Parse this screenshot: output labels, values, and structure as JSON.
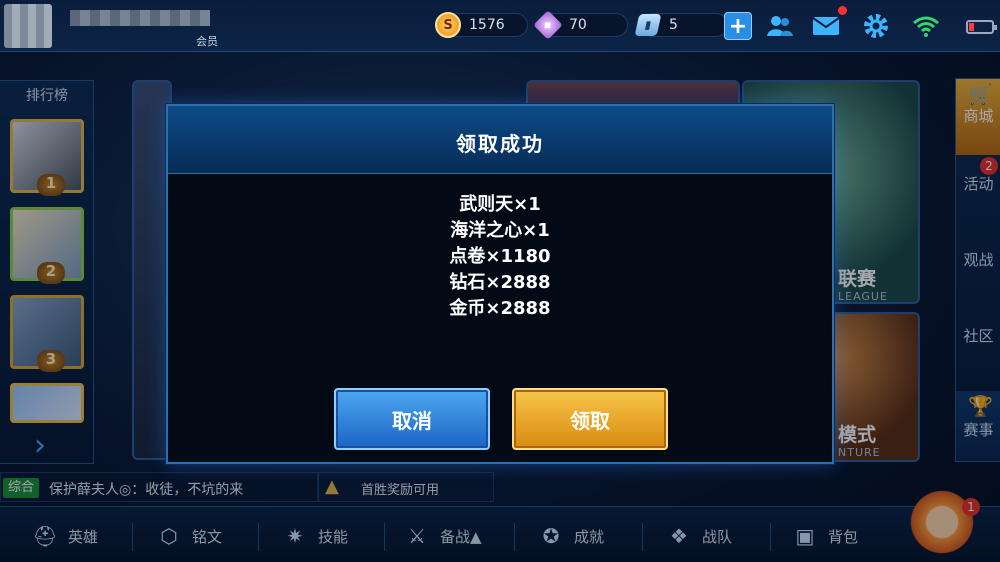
{
  "topbar": {
    "vip_label": "会员",
    "coins": "1576",
    "diamonds": "70",
    "vouchers": "5",
    "coin_icon_glyph": "S",
    "plus_glyph": "+"
  },
  "ranking": {
    "title": "排行榜",
    "ranks": [
      "1",
      "2",
      "3"
    ]
  },
  "background": {
    "league_label": "联赛",
    "league_sub": "LEAGUE",
    "adventure_label": "模式",
    "adventure_sub": "NTURE"
  },
  "side_menu": {
    "shop": "商城",
    "events": "活动",
    "events_badge": "2",
    "watch": "观战",
    "community": "社区",
    "contest": "赛事"
  },
  "chat": {
    "channel": "综合",
    "message": "保护薛夫人◎：收徒，不坑的来"
  },
  "first_win": {
    "text": "首胜奖励可用"
  },
  "nav": {
    "hero": "英雄",
    "rune": "铭文",
    "skill": "技能",
    "prep": "备战▲",
    "achievement": "成就",
    "team": "战队",
    "bag": "背包",
    "mascot_badge": "1"
  },
  "modal": {
    "title": "领取成功",
    "rewards": [
      "武则天×1",
      "海洋之心×1",
      "点卷×1180",
      "钻石×2888",
      "金币×2888"
    ],
    "cancel_label": "取消",
    "claim_label": "领取"
  },
  "colors": {
    "accent_blue": "#3db4ff",
    "claim_gold": "#f7c64a",
    "cancel_blue": "#1c64c4",
    "badge_red": "#e8312d"
  }
}
